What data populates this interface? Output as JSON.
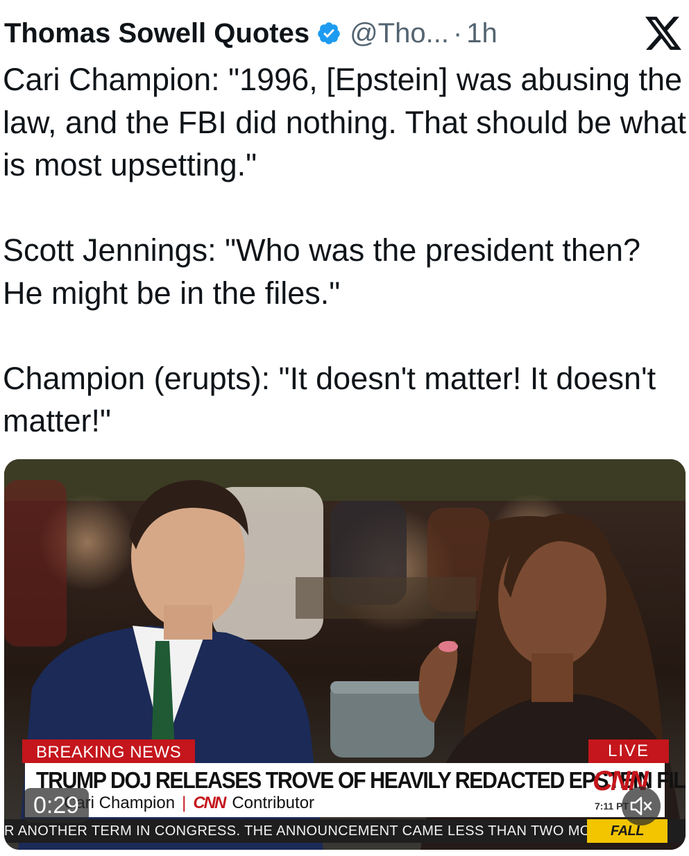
{
  "tweet": {
    "author_name": "Thomas Sowell Quotes",
    "handle": "@Tho...",
    "separator": "·",
    "time_ago": "1h",
    "paragraphs": [
      "Cari Champion: \"1996, [Epstein] was abusing the law, and the FBI did nothing. That should be what is most upsetting.\"",
      "Scott Jennings: \"Who was the president then? He might be in the files.\"",
      "Champion (erupts): \"It doesn't matter! It doesn't matter!\""
    ]
  },
  "icons": {
    "verified": "verified-badge-icon",
    "platform": "x-logo-icon",
    "mute": "speaker-muted-icon"
  },
  "colors": {
    "verified_blue": "#1d9bf0",
    "handle_gray": "#536471",
    "cnn_red": "#c4161c",
    "ticker_yellow": "#f2c500"
  },
  "video": {
    "duration": "0:29",
    "chyron": {
      "breaking_label": "BREAKING NEWS",
      "live_label": "LIVE",
      "headline": "TRUMP DOJ RELEASES TROVE OF HEAVILY REDACTED EPSTEIN FILES",
      "network_logo": "CNN",
      "name_line": "Cari Champion",
      "name_separator": "|",
      "network_small": "CNN",
      "title_line": "Contributor",
      "clock": "7:11 PT",
      "ticker": "R ANOTHER TERM IN CONGRESS. THE ANNOUNCEMENT CAME LESS THAN TWO MONT",
      "promo": "FALL FRIDAYS"
    }
  }
}
